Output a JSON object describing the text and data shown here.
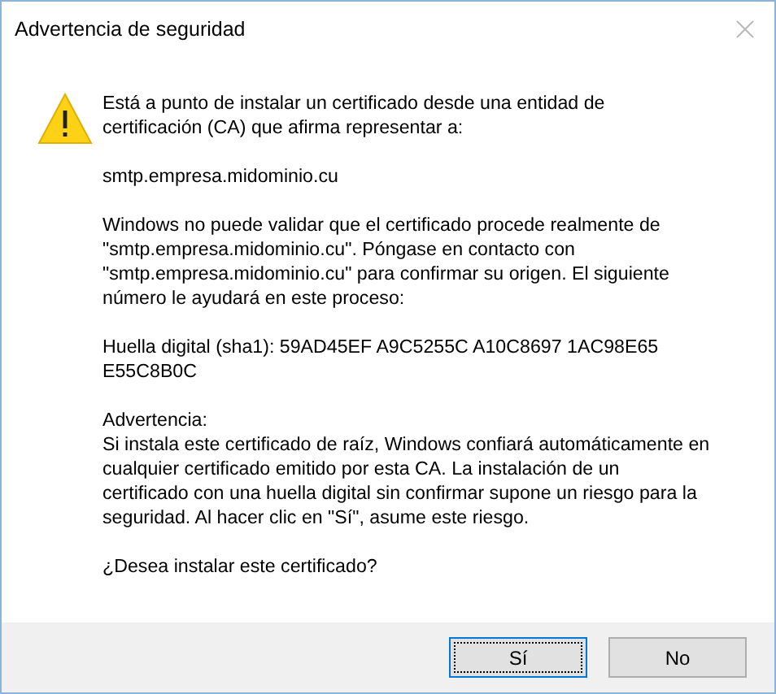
{
  "window": {
    "title": "Advertencia de seguridad"
  },
  "message": {
    "paragraphs": [
      {
        "lines": [
          "Está a punto de instalar un certificado desde una entidad de",
          "certificación (CA) que afirma representar a:"
        ]
      },
      {
        "lines": [
          "smtp.empresa.midominio.cu"
        ]
      },
      {
        "lines": [
          "Windows no puede validar que el certificado procede realmente de",
          "\"smtp.empresa.midominio.cu\". Póngase en contacto con",
          "\"smtp.empresa.midominio.cu\" para confirmar su origen. El siguiente",
          "número le ayudará en este proceso:"
        ]
      },
      {
        "lines": [
          "Huella digital (sha1): 59AD45EF A9C5255C A10C8697 1AC98E65",
          "E55C8B0C"
        ]
      },
      {
        "lines": [
          "Advertencia:",
          "Si instala este certificado de raíz, Windows confiará automáticamente en",
          "cualquier certificado emitido por esta CA. La instalación de un",
          "certificado con una huella digital sin confirmar supone un riesgo para la",
          "seguridad. Al hacer clic en \"Sí\", asume este riesgo."
        ]
      },
      {
        "lines": [
          "¿Desea instalar este certificado?"
        ]
      }
    ]
  },
  "buttons": [
    {
      "label": "Sí",
      "default": true
    },
    {
      "label": "No",
      "default": false
    }
  ]
}
